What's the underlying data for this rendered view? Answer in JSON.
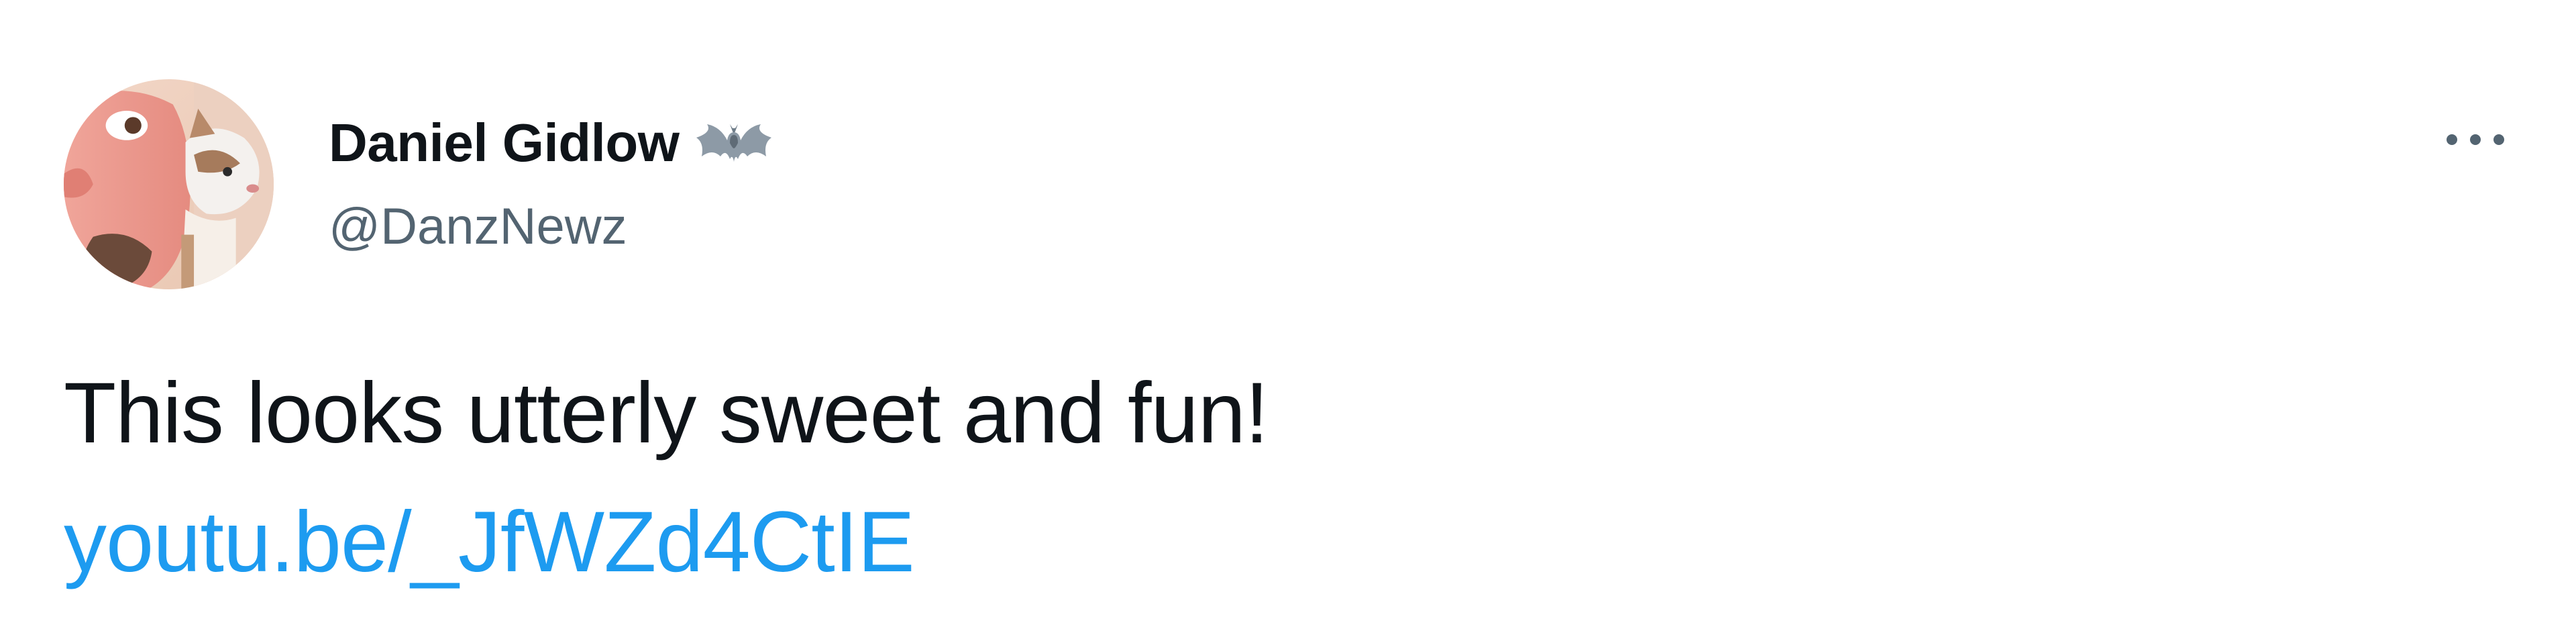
{
  "author": {
    "display_name": "Daniel Gidlow",
    "handle": "@DanzNewz",
    "name_badge_icon": "bat-icon",
    "avatar_icon": "avatar-photo"
  },
  "actions": {
    "more_icon": "more-horizontal-icon"
  },
  "tweet": {
    "text": "This looks utterly sweet and fun!",
    "link_text": "youtu.be/_JfWZd4CtIE"
  },
  "colors": {
    "name": "#0f1419",
    "handle": "#536471",
    "link": "#1d9bf0",
    "background": "#ffffff"
  }
}
